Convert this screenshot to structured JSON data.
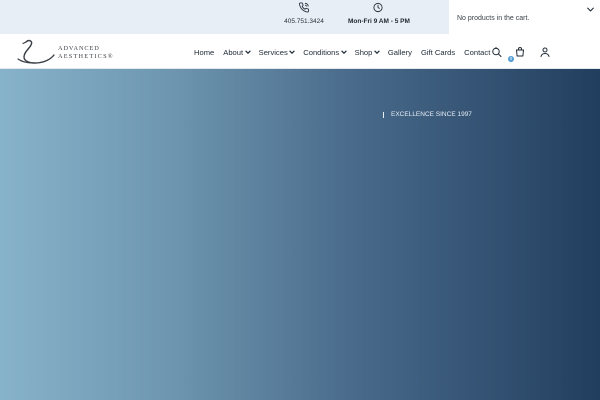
{
  "topbar": {
    "phone": {
      "icon": "phone-icon",
      "text": "405.751.3424"
    },
    "hours": {
      "icon": "clock-icon",
      "text": "Mon-Fri 9 AM - 5 PM"
    }
  },
  "cart_dropdown": {
    "message": "No products in the cart.",
    "icon": "chevron-down-icon"
  },
  "header": {
    "logo": {
      "line1": "ADVANCED",
      "line2": "AESTHETICS®",
      "icon": "swan-logo-icon"
    },
    "nav": {
      "home": "Home",
      "about": "About",
      "services": "Services",
      "conditions": "Conditions",
      "shop": "Shop",
      "gallery": "Gallery",
      "gift_cards": "Gift Cards",
      "contact": "Contact"
    },
    "icons": [
      "search-icon",
      "cart-icon",
      "user-icon"
    ],
    "cart_count": "0"
  },
  "hero": {
    "tagline": "EXCELLENCE SINCE 1997"
  },
  "colors": {
    "topbar_bg": "#e7eef6",
    "hero_start": "#87b3ca",
    "hero_end": "#223e5e",
    "badge": "#4e9bd4"
  }
}
